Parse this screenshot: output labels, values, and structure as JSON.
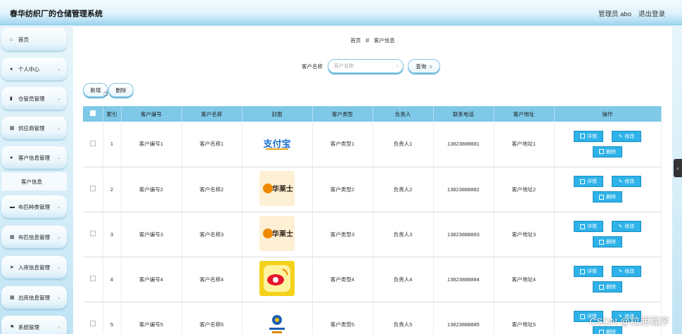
{
  "app": {
    "title": "春华纺织厂的仓储管理系统",
    "user": "管理员 abo",
    "logout": "退出登录"
  },
  "sidebar": {
    "items": [
      {
        "label": "首页",
        "icon": "home-icon"
      },
      {
        "label": "个人中心",
        "icon": "user-icon"
      },
      {
        "label": "仓管员管理",
        "icon": "bar-chart-icon"
      },
      {
        "label": "供应商管理",
        "icon": "grid-icon"
      },
      {
        "label": "客户信息管理",
        "icon": "user-icon"
      },
      {
        "label": "客户信息",
        "icon": ""
      },
      {
        "label": "布匹种类管理",
        "icon": "monitor-icon"
      },
      {
        "label": "布匹信息管理",
        "icon": "grid-icon"
      },
      {
        "label": "入库信息管理",
        "icon": "send-icon"
      },
      {
        "label": "出库信息管理",
        "icon": "grid-icon"
      },
      {
        "label": "系统管理",
        "icon": "flag-icon"
      }
    ]
  },
  "breadcrumb": {
    "home": "首页",
    "sep": "//",
    "current": "客户信息"
  },
  "search": {
    "label": "客户名称",
    "placeholder": "客户名称",
    "button": "查询"
  },
  "actions": {
    "add": "新增",
    "delete": "删除"
  },
  "table": {
    "headers": [
      "索引",
      "客户编号",
      "客户名称",
      "封面",
      "客户类型",
      "负责人",
      "联系电话",
      "客户地址",
      "操作"
    ],
    "rows": [
      {
        "index": "1",
        "code": "客户编号1",
        "name": "客户名称1",
        "cover": "支付宝",
        "type": "客户类型1",
        "owner": "负责人1",
        "phone": "13823888881",
        "address": "客户地址1"
      },
      {
        "index": "2",
        "code": "客户编号2",
        "name": "客户名称2",
        "cover": "华莱士",
        "type": "客户类型2",
        "owner": "负责人2",
        "phone": "13823888882",
        "address": "客户地址2"
      },
      {
        "index": "3",
        "code": "客户编号3",
        "name": "客户名称3",
        "cover": "华莱士",
        "type": "客户类型3",
        "owner": "负责人3",
        "phone": "13823888883",
        "address": "客户地址3"
      },
      {
        "index": "4",
        "code": "客户编号4",
        "name": "客户名称4",
        "cover": "",
        "type": "客户类型4",
        "owner": "负责人4",
        "phone": "13823888884",
        "address": "客户地址4"
      },
      {
        "index": "5",
        "code": "客户编号5",
        "name": "客户名称5",
        "cover": "",
        "type": "客户类型5",
        "owner": "负责人5",
        "phone": "13823888885",
        "address": "客户地址5"
      }
    ],
    "ops": {
      "detail": "详情",
      "edit": "修改",
      "delete": "删除"
    }
  },
  "watermark": "CSDN @拉朋程序",
  "colors": {
    "header": "#7ec8e8",
    "op_button": "#2db2e9",
    "accent_border": "#6fb9de"
  }
}
